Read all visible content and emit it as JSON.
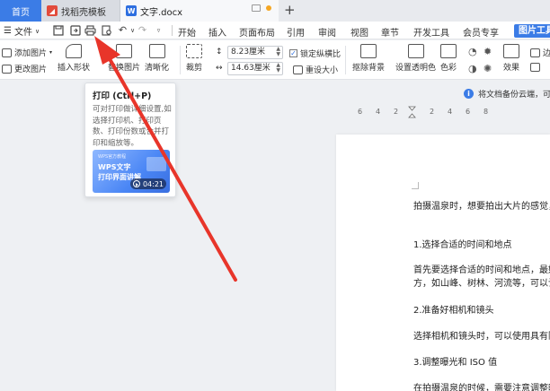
{
  "tabs": {
    "home": "首页",
    "template": "找稻壳模板",
    "document": "文字.docx"
  },
  "menubar": {
    "file": "文件",
    "items": [
      "开始",
      "插入",
      "页面布局",
      "引用",
      "审阅",
      "视图",
      "章节",
      "开发工具",
      "会员专享"
    ],
    "picture_tools": "图片工具"
  },
  "ribbon": {
    "add_picture": "添加图片",
    "change_picture": "更改图片",
    "insert_shape": "插入形状",
    "replace_picture": "替换图片",
    "sharpen": "清晰化",
    "crop": "裁剪",
    "height": "8.23厘米",
    "width": "14.63厘米",
    "lock_ratio": "锁定纵横比",
    "reset_size": "重设大小",
    "remove_bg": "抠除背景",
    "set_transparent": "设置透明色",
    "color": "色彩",
    "effects": "效果",
    "border_partial": "边"
  },
  "notice": {
    "text": "将文档备份云端，可避"
  },
  "ruler": {
    "labels": [
      "6",
      "4",
      "2",
      "2",
      "4",
      "6",
      "8"
    ]
  },
  "tooltip": {
    "title": "打印 (Ctrl+P)",
    "description": "可对打印做详细设置,如选择打印机、打印页数、打印份数或合并打印和缩放等。",
    "video_brand": "WPS官方教程",
    "video_line1": "WPS文字",
    "video_line2": "打印界面讲解",
    "video_time": "04:21"
  },
  "document": {
    "lines": [
      "拍摄温泉时，想要拍出大片的感觉，",
      "1.选择合适的时间和地点",
      "首先要选择合适的时间和地点，最好",
      "方，如山峰、树林、河流等，可以让",
      "2.准备好相机和镜头",
      "选择相机和镜头时，可以使用具有防",
      "3.调整曝光和 ISO 值",
      "在拍摄温泉的时候，需要注意调整曝"
    ]
  },
  "colors": {
    "accent": "#3b7ce6",
    "arrow": "#e8352a",
    "template_icon": "#e24b3b"
  }
}
